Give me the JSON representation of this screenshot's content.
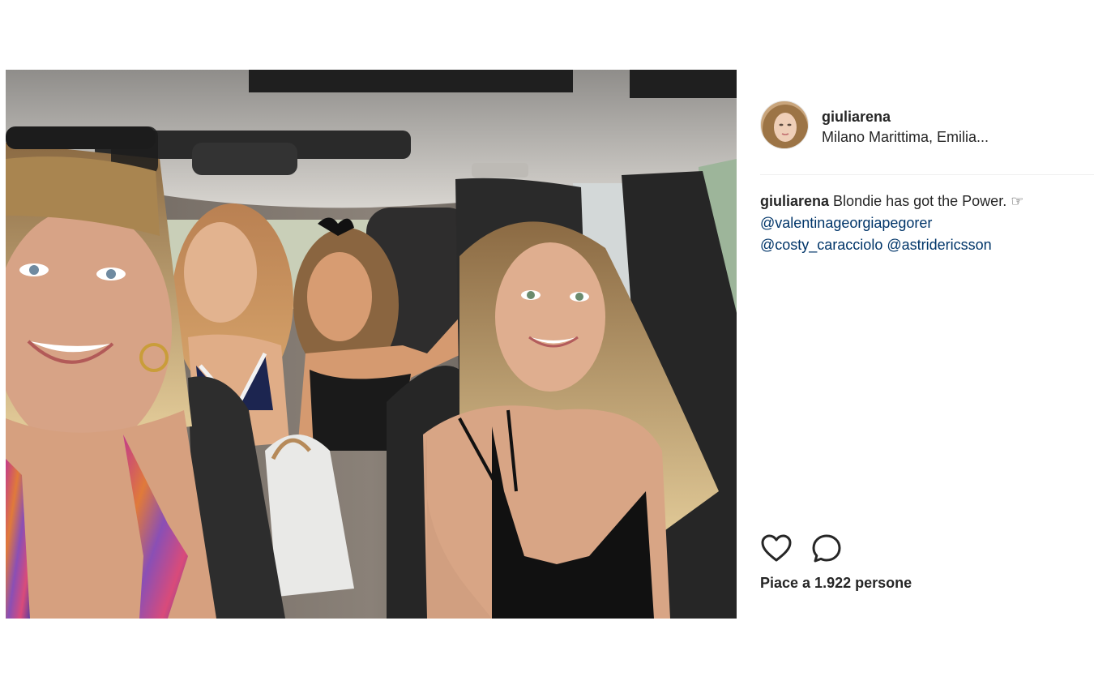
{
  "post": {
    "username": "giuliarena",
    "location": "Milano Marittima, Emilia...",
    "caption": {
      "username": "giuliarena",
      "text": "Blondie has got the Power. ☞",
      "mention_1": "@valentinageorgiapegorer",
      "mention_2": "@costy_caracciolo",
      "mention_3": "@astridericsson"
    },
    "likes_text": "Piace a 1.922 persone",
    "icons": {
      "like": "heart-icon",
      "comment": "comment-bubble-icon"
    },
    "colors": {
      "text": "#262626",
      "mention": "#003569",
      "divider": "#efefef"
    }
  }
}
